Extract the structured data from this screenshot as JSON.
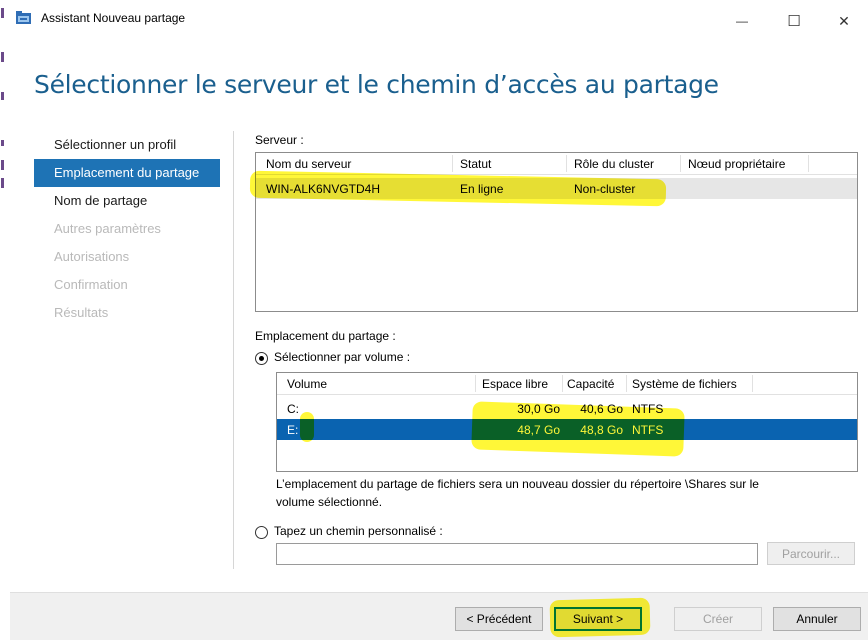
{
  "window": {
    "title": "Assistant Nouveau partage",
    "minimize_glyph": "—",
    "maximize_glyph": "☐",
    "close_glyph": "✕"
  },
  "heading": "Sélectionner le serveur et le chemin d’accès au partage",
  "nav": [
    {
      "label": "Sélectionner un profil",
      "state": "normal"
    },
    {
      "label": "Emplacement du partage",
      "state": "active"
    },
    {
      "label": "Nom de partage",
      "state": "normal"
    },
    {
      "label": "Autres paramètres",
      "state": "disabled"
    },
    {
      "label": "Autorisations",
      "state": "disabled"
    },
    {
      "label": "Confirmation",
      "state": "disabled"
    },
    {
      "label": "Résultats",
      "state": "disabled"
    }
  ],
  "server": {
    "label": "Serveur :",
    "columns": [
      "Nom du serveur",
      "Statut",
      "Rôle du cluster",
      "Nœud propriétaire"
    ],
    "rows": [
      {
        "name": "WIN-ALK6NVGTD4H",
        "status": "En ligne",
        "role": "Non-cluster",
        "owner": ""
      }
    ]
  },
  "location": {
    "label": "Emplacement du partage :",
    "by_volume_label": "Sélectionner par volume :",
    "by_volume_selected": true,
    "volume_columns": [
      "Volume",
      "Espace libre",
      "Capacité",
      "Système de fichiers"
    ],
    "volumes": [
      {
        "volume": "C:",
        "free": "30,0 Go",
        "capacity": "40,6 Go",
        "fs": "NTFS",
        "selected": false
      },
      {
        "volume": "E:",
        "free": "48,7 Go",
        "capacity": "48,8 Go",
        "fs": "NTFS",
        "selected": true
      }
    ],
    "info_line1": "L’emplacement du partage de fichiers sera un nouveau dossier du répertoire \\Shares sur le",
    "info_line2": "volume sélectionné.",
    "custom_path_label": "Tapez un chemin personnalisé :",
    "custom_path_value": "",
    "browse_label": "Parcourir..."
  },
  "buttons": {
    "previous": "< Précédent",
    "next": "Suivant >",
    "create": "Créer",
    "cancel": "Annuler"
  },
  "colors": {
    "heading": "#1a5f8e",
    "nav_active": "#1e73b5",
    "selected_row": "#0a63b0",
    "highlighter": "#fff500"
  }
}
